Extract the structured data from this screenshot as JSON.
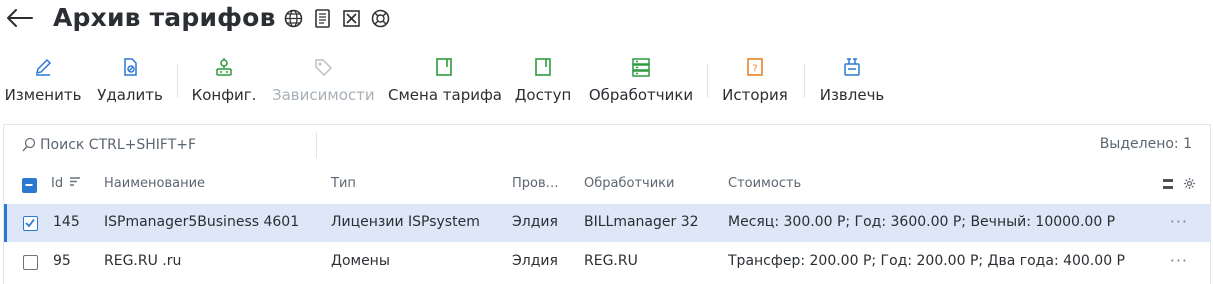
{
  "page": {
    "title": "Архив тарифов"
  },
  "header_icons": [
    "globe-icon",
    "document-list-icon",
    "excel-export-icon",
    "help-lifebuoy-icon"
  ],
  "toolbar": [
    {
      "label": "Изменить",
      "icon": "pencil-icon",
      "disabled": false
    },
    {
      "label": "Удалить",
      "icon": "delete-icon",
      "disabled": false
    },
    {
      "label": "Конфиг.",
      "icon": "config-icon",
      "disabled": false
    },
    {
      "label": "Зависимости",
      "icon": "tag-icon",
      "disabled": true
    },
    {
      "label": "Смена тарифа",
      "icon": "tariff-change-icon",
      "disabled": false
    },
    {
      "label": "Доступ",
      "icon": "access-icon",
      "disabled": false
    },
    {
      "label": "Обработчики",
      "icon": "handlers-icon",
      "disabled": false
    },
    {
      "label": "История",
      "icon": "history-icon",
      "disabled": false
    },
    {
      "label": "Извлечь",
      "icon": "extract-icon",
      "disabled": false
    }
  ],
  "search": {
    "placeholder": "Поиск CTRL+SHIFT+F"
  },
  "selection": {
    "text": "Выделено: 1"
  },
  "table": {
    "columns": [
      "Id",
      "Наименование",
      "Тип",
      "Пров…",
      "Обработчики",
      "Стоимость"
    ],
    "rows": [
      {
        "id": "145",
        "name": "ISPmanager5Business 4601",
        "type": "Лицензии ISPsystem",
        "provider": "Элдия",
        "handler": "BILLmanager 32",
        "price": "Месяц: 300.00 Р; Год: 3600.00 Р; Вечный: 10000.00 Р",
        "selected": true
      },
      {
        "id": "95",
        "name": "REG.RU .ru",
        "type": "Домены",
        "provider": "Элдия",
        "handler": "REG.RU",
        "price": "Трансфер: 200.00 Р; Год: 200.00 Р; Два года: 400.00 Р",
        "selected": false
      }
    ]
  },
  "colors": {
    "accent": "#2b79d3",
    "green": "#2e9a3f",
    "orange": "#e8832a",
    "selected_row": "#dde7f7",
    "disabled": "#a8afb6"
  }
}
